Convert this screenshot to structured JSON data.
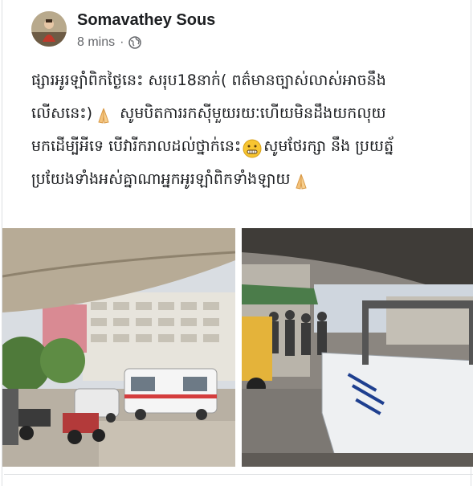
{
  "post": {
    "author": "Somavathey Sous",
    "time": "8 mins",
    "separator": "·",
    "privacy_icon": "globe-icon",
    "text_line1": "ផ្សារអូរឡាំពិកថ្ងៃនេះ សរុប18នាក់( ពត៌មានច្បាស់លាស់អាចនឹង",
    "text_line2a": "លើសនេះ)",
    "text_line2b": " សូមបិតការរកស៊ីមួយរយៈហើយមិនដឹងយកលុយ",
    "text_line3a": "មកដើម្បីអីទេ បើវារីករាលដល់ថ្នាក់នេះ",
    "text_line3b": "សូមថែរក្សា នឹង ប្រយត្ន័",
    "text_line4": "ប្រយែងទាំងអស់គ្នាណាអ្នកអូរឡាំពិកទាំងឡាយ",
    "emojis": [
      "folded-hands-emoji",
      "grimacing-face-emoji",
      "folded-hands-emoji"
    ]
  },
  "photos": [
    {
      "name": "market-street-ambulance-photo"
    },
    {
      "name": "street-truck-photo"
    }
  ]
}
